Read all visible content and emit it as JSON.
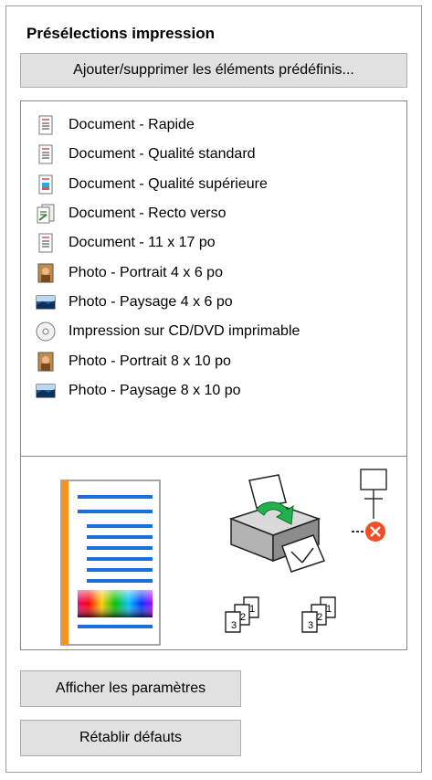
{
  "panel": {
    "title": "Présélections impression",
    "add_remove_label": "Ajouter/supprimer les éléments prédéfinis...",
    "show_settings_label": "Afficher les paramètres",
    "reset_defaults_label": "Rétablir défauts"
  },
  "presets": [
    {
      "label": "Document - Rapide",
      "icon": "document-icon"
    },
    {
      "label": "Document - Qualité standard",
      "icon": "document-icon"
    },
    {
      "label": "Document - Qualité supérieure",
      "icon": "document-color-icon"
    },
    {
      "label": "Document - Recto verso",
      "icon": "duplex-document-icon"
    },
    {
      "label": "Document - 11 x 17 po",
      "icon": "document-icon"
    },
    {
      "label": "Photo - Portrait 4 x 6 po",
      "icon": "photo-portrait-icon"
    },
    {
      "label": "Photo - Paysage 4 x 6 po",
      "icon": "photo-landscape-icon"
    },
    {
      "label": "Impression sur CD/DVD imprimable",
      "icon": "cd-icon"
    },
    {
      "label": "Photo - Portrait 8 x 10 po",
      "icon": "photo-portrait-icon"
    },
    {
      "label": "Photo - Paysage 8 x 10 po",
      "icon": "photo-landscape-icon"
    }
  ],
  "preview": {
    "copies_icon_label_a": "1",
    "copies_icon_label_b": "2",
    "copies_icon_label_c": "3"
  }
}
